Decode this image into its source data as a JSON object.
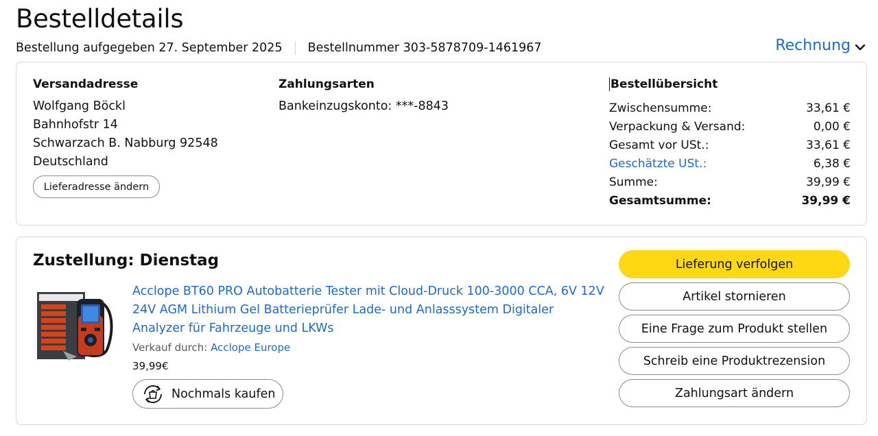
{
  "page": {
    "title": "Bestelldetails",
    "order_date": "Bestellung aufgegeben 27. September 2025",
    "order_number": "Bestellnummer 303-5878709-1461967",
    "invoice_label": "Rechnung"
  },
  "shipping": {
    "title": "Versandadresse",
    "lines": [
      "Wolfgang Böckl",
      "Bahnhofstr 14",
      "Schwarzach B. Nabburg 92548",
      "Deutschland"
    ],
    "change_button": "Lieferadresse ändern"
  },
  "payment": {
    "title": "Zahlungsarten",
    "method": "Bankeinzugskonto: ***-8843"
  },
  "summary": {
    "title": "Bestellübersicht",
    "rows": [
      {
        "label": "Zwischensumme:",
        "value": "33,61 €"
      },
      {
        "label": "Verpackung & Versand:",
        "value": "0,00 €"
      },
      {
        "label": "Gesamt vor USt.:",
        "value": "33,61 €"
      },
      {
        "label": "Geschätzte USt.:",
        "value": "6,38 €"
      },
      {
        "label": "Summe:",
        "value": "39,99 €"
      },
      {
        "label": "Gesamtsumme:",
        "value": "39,99 €"
      }
    ]
  },
  "delivery": {
    "title": "Zustellung: Dienstag",
    "product_title": "Acclope BT60 PRO Autobatterie Tester mit Cloud-Druck 100-3000 CCA, 6V 12V 24V AGM Lithium Gel Batterieprüfer Lade- und Anlasssystem Digitaler Analyzer für Fahrzeuge und LKWs",
    "seller_prefix": "Verkauf durch:",
    "seller_name": "Acclope Europe",
    "price": "39,99€",
    "buy_again": "Nochmals kaufen"
  },
  "actions": {
    "track": "Lieferung verfolgen",
    "cancel": "Artikel stornieren",
    "question": "Eine Frage zum Produkt stellen",
    "review": "Schreib eine Produktrezension",
    "change_payment": "Zahlungsart ändern"
  },
  "colors": {
    "link": "#1b6ac9",
    "primary_button": "#ffd814",
    "border": "#d5d9d9"
  }
}
